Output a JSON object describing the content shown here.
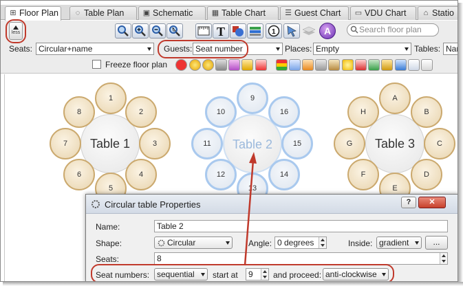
{
  "tabs": [
    {
      "label": "Floor Plan",
      "icon": "grid-icon",
      "active": true
    },
    {
      "label": "Table Plan",
      "icon": "circle-dots-icon"
    },
    {
      "label": "Schematic",
      "icon": "monitor-icon"
    },
    {
      "label": "Table Chart",
      "icon": "table-icon"
    },
    {
      "label": "Guest Chart",
      "icon": "list-icon"
    },
    {
      "label": "VDU Chart",
      "icon": "monitor-icon"
    },
    {
      "label": "Statio",
      "icon": "tag-icon"
    }
  ],
  "less_button": {
    "label": "less"
  },
  "search": {
    "placeholder": "Search floor plan"
  },
  "seats": {
    "label": "Seats:",
    "value": "Circular+name"
  },
  "guests": {
    "label": "Guests:",
    "value": "Seat number"
  },
  "places": {
    "label": "Places:",
    "value": "Empty"
  },
  "tables": {
    "label": "Tables:",
    "value": "Nam"
  },
  "freeze": {
    "label": "Freeze floor plan"
  },
  "floor": {
    "tables": [
      {
        "name": "Table 1",
        "seats": [
          "1",
          "2",
          "3",
          "4",
          "5",
          "6",
          "7",
          "8"
        ],
        "selected": false
      },
      {
        "name": "Table 2",
        "seats": [
          "9",
          "16",
          "15",
          "14",
          "13",
          "12",
          "11",
          "10"
        ],
        "selected": true
      },
      {
        "name": "Table 3",
        "seats": [
          "A",
          "B",
          "C",
          "D",
          "E",
          "F",
          "G",
          "H"
        ],
        "selected": false
      }
    ]
  },
  "dialog": {
    "title": "Circular table Properties",
    "help": "?",
    "close": "✕",
    "name_label": "Name:",
    "name_value": "Table 2",
    "shape_label": "Shape:",
    "shape_value": "Circular",
    "angle_label": "Angle:",
    "angle_value": "0 degrees",
    "inside_label": "Inside:",
    "inside_value": "gradient",
    "more_label": "...",
    "seats_label": "Seats:",
    "seats_value": "8",
    "seatnum_label": "Seat numbers:",
    "seatnum_value": "sequential",
    "start_label": "start at",
    "start_value": "9",
    "proceed_label": "and proceed:",
    "proceed_value": "anti-clockwise"
  },
  "colors": {
    "highlight": "#c0392b",
    "accent_blue": "#a9c9ee",
    "seat_gold": "#cba96e"
  }
}
